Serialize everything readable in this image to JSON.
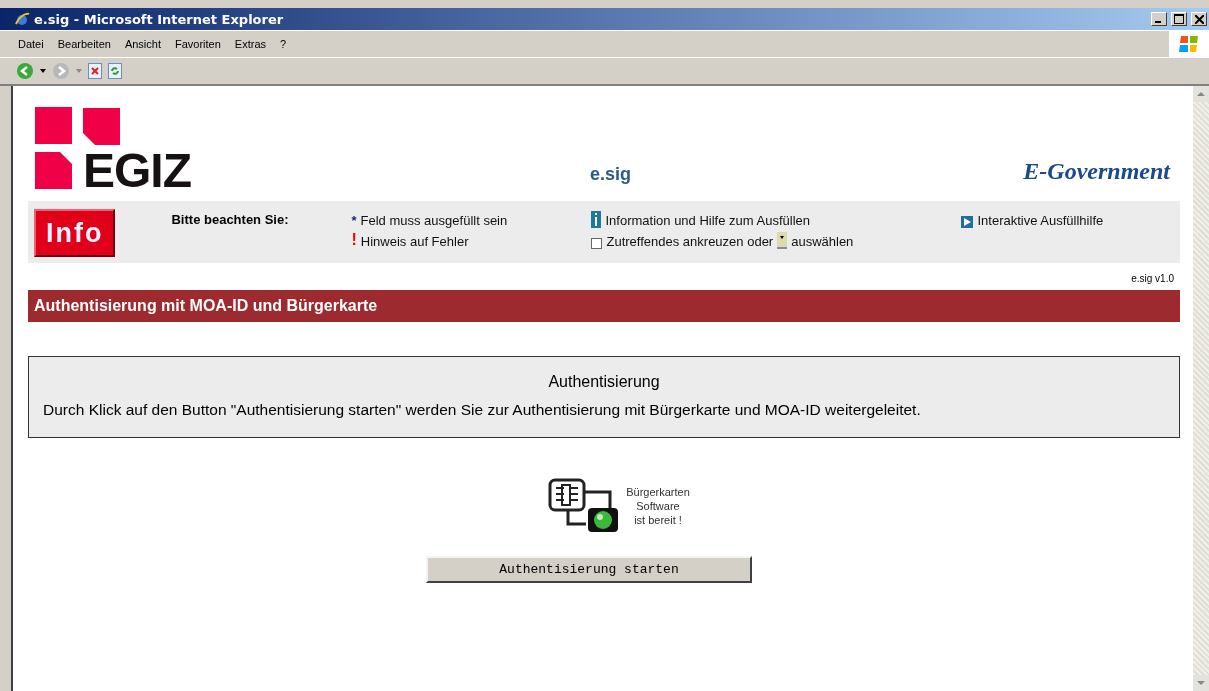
{
  "window": {
    "title": "e.sig - Microsoft Internet Explorer"
  },
  "menu": [
    "Datei",
    "Bearbeiten",
    "Ansicht",
    "Favoriten",
    "Extras",
    "?"
  ],
  "header": {
    "logo": "EGIZ",
    "center": "e.sig",
    "right": "E-Government"
  },
  "info": {
    "badge": "Info",
    "heading": "Bitte beachten Sie:",
    "legend": [
      {
        "kind": "asterisk",
        "mark": "*",
        "text": "Feld muss ausgefüllt sein"
      },
      {
        "kind": "info",
        "text": "Information und Hilfe zum Ausfüllen"
      },
      {
        "kind": "help",
        "text": "Interaktive Ausfüllhilfe"
      },
      {
        "kind": "error",
        "mark": "!",
        "text": "Hinweis auf Fehler"
      },
      {
        "kind": "select",
        "text": "Zutreffendes ankreuzen oder",
        "text2": "auswählen"
      }
    ]
  },
  "version": "e.sig v1.0",
  "section_title": "Authentisierung mit MOA-ID und Bürgerkarte",
  "box": {
    "title": "Authentisierung",
    "text": "Durch Klick auf den Button \"Authentisierung starten\" werden Sie zur Authentisierung mit Bürgerkarte und MOA-ID weitergeleitet."
  },
  "status": {
    "text": "Bürgerkarten\nSoftware\nist bereit !"
  },
  "button": "Authentisierung starten"
}
